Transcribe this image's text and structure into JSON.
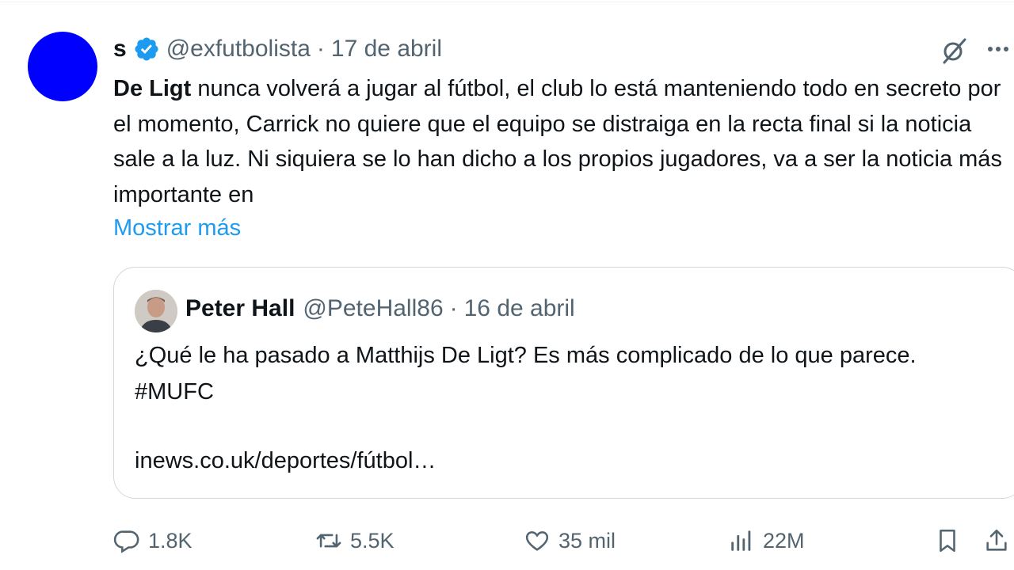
{
  "tweet": {
    "author_name": "s",
    "handle": "@exfutbolista",
    "separator": "·",
    "date": "17 de abril",
    "avatar_color": "#0000ff",
    "verified_color": "#1d9bf0",
    "text_mention": "De Ligt",
    "text_body": " nunca volverá a jugar al fútbol, el club lo está manteniendo todo en secreto por el momento, Carrick no quiere que el equipo se distraiga en la recta final si la noticia sale a la luz. Ni siquiera se lo han dicho a los propios jugadores, va a ser la noticia más importante en",
    "show_more": "Mostrar más",
    "grok_icon": "grok-icon",
    "more_icon": "more-icon"
  },
  "quote": {
    "author_name": "Peter Hall",
    "handle": "@PeteHall86",
    "separator": "·",
    "date": "16 de abril",
    "text": "¿Qué le ha pasado a Matthijs De Ligt? Es más complicado de lo que parece. #MUFC",
    "link": "inews.co.uk/deportes/fútbol…"
  },
  "actions": {
    "replies": "1.8K",
    "retweets": "5.5K",
    "likes": "35 mil",
    "views": "22M"
  },
  "colors": {
    "secondary_text": "#536471",
    "link": "#1d9bf0",
    "border": "#cfd9de"
  }
}
